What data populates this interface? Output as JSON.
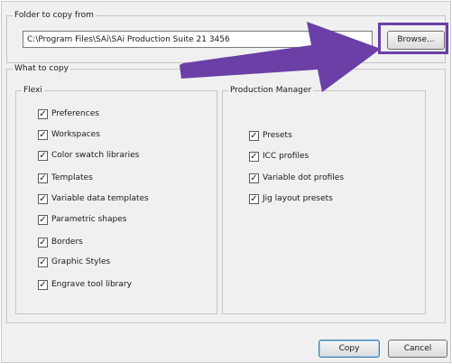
{
  "folder_section": {
    "legend": "Folder to copy from",
    "path_value": "C:\\Program Files\\SAi\\SAi Production Suite 21 3456",
    "browse_label": "Browse..."
  },
  "what_section": {
    "legend": "What to copy",
    "flexi": {
      "legend": "Flexi",
      "items": [
        {
          "label": "Preferences",
          "checked": true
        },
        {
          "label": "Workspaces",
          "checked": true
        },
        {
          "label": "Color swatch libraries",
          "checked": true
        },
        {
          "label": "Templates",
          "checked": true
        },
        {
          "label": "Variable data templates",
          "checked": true
        },
        {
          "label": "Parametric shapes",
          "checked": true
        },
        {
          "label": "Borders",
          "checked": true
        },
        {
          "label": "Graphic Styles",
          "checked": true
        },
        {
          "label": "Engrave tool library",
          "checked": true
        }
      ]
    },
    "production_manager": {
      "legend": "Production Manager",
      "items": [
        {
          "label": "Presets",
          "checked": true
        },
        {
          "label": "ICC profiles",
          "checked": true
        },
        {
          "label": "Variable dot profiles",
          "checked": true
        },
        {
          "label": "Jig layout presets",
          "checked": true
        }
      ]
    }
  },
  "footer": {
    "copy_label": "Copy",
    "cancel_label": "Cancel"
  },
  "check_glyph": "✓",
  "annotation": {
    "color": "#6a3fa6",
    "target": "browse-button"
  }
}
